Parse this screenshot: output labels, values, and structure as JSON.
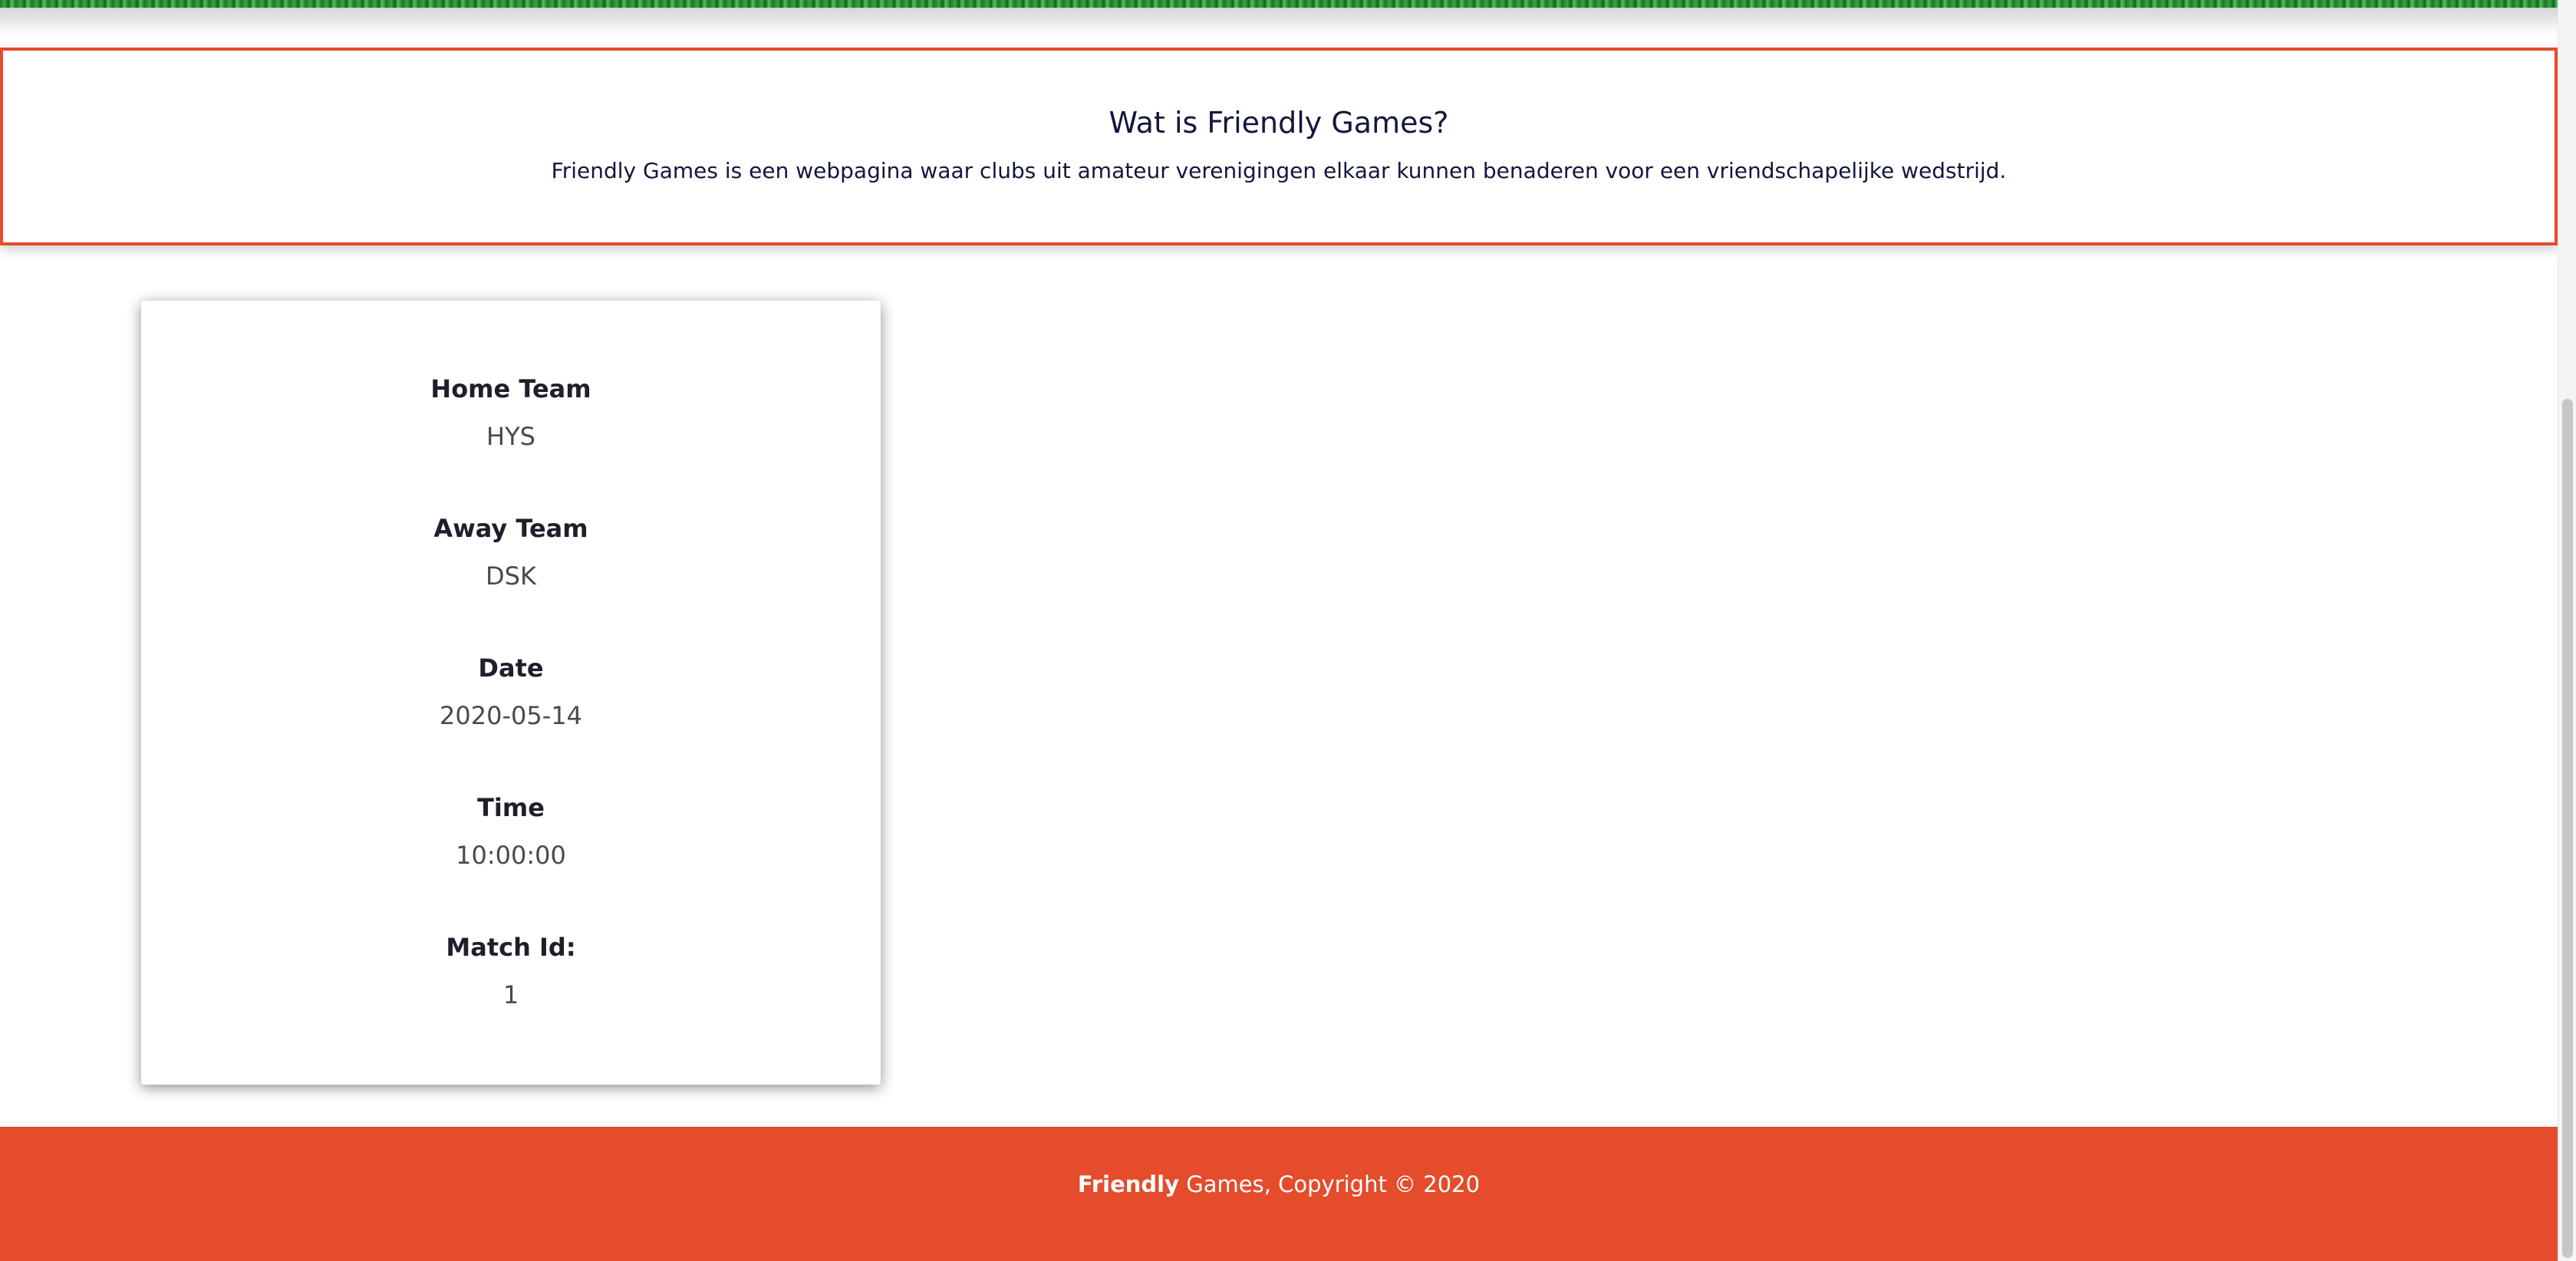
{
  "intro": {
    "title": "Wat is Friendly Games?",
    "description": "Friendly Games is een webpagina waar clubs uit amateur verenigingen elkaar kunnen benaderen voor een vriendschapelijke wedstrijd."
  },
  "match": {
    "home_team_label": "Home Team",
    "home_team": "HYS",
    "away_team_label": "Away Team",
    "away_team": "DSK",
    "date_label": "Date",
    "date": "2020-05-14",
    "time_label": "Time",
    "time": "10:00:00",
    "match_id_label": "Match Id:",
    "match_id": "1"
  },
  "footer": {
    "brand_bold": "Friendly",
    "rest": " Games, Copyright © 2020"
  },
  "colors": {
    "accent": "#e44c2c",
    "heading": "#14163d",
    "grass": "#2e8b35"
  }
}
